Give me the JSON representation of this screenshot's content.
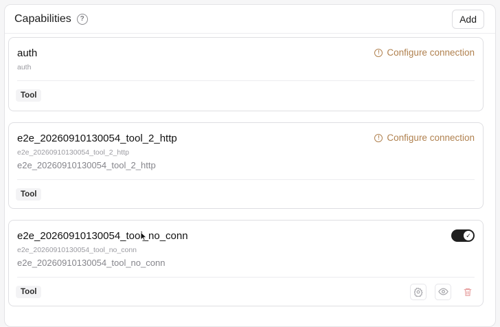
{
  "header": {
    "title": "Capabilities",
    "add_label": "Add"
  },
  "configure_label": "Configure connection",
  "capabilities": [
    {
      "title": "auth",
      "subtitle": "auth",
      "tag": "Tool"
    },
    {
      "title": "e2e_20260910130054_tool_2_http",
      "subtitle": "e2e_20260910130054_tool_2_http",
      "description": "e2e_20260910130054_tool_2_http",
      "tag": "Tool"
    },
    {
      "title": "e2e_20260910130054_tool_no_conn",
      "subtitle": "e2e_20260910130054_tool_no_conn",
      "description": "e2e_20260910130054_tool_no_conn",
      "tag": "Tool",
      "enabled": true
    }
  ],
  "icons": {
    "help": "question-circle-icon",
    "warning": "alert-circle-icon",
    "settings": "gear-icon",
    "view": "eye-icon",
    "delete": "trash-icon"
  },
  "colors": {
    "warning": "#b0814f",
    "toggle_on": "#1f1f1f",
    "delete": "#e8a3a3"
  }
}
